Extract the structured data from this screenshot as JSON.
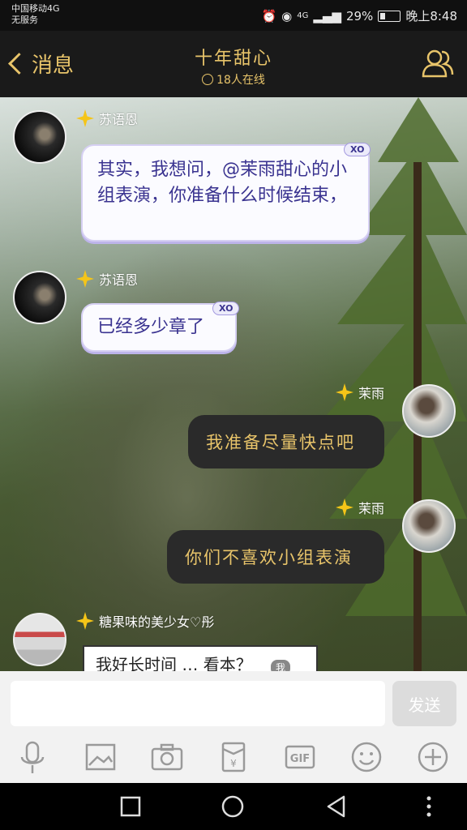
{
  "status_bar": {
    "carrier_line1": "中国移动4G",
    "carrier_line2": "无服务",
    "network": "4G",
    "battery": "29%",
    "time": "晚上8:48"
  },
  "header": {
    "back_label": "消息",
    "title": "十年甜心",
    "online": "18人在线"
  },
  "messages": [
    {
      "sender": "苏语恩",
      "text": "其实，我想问，@茉雨甜心的小组表演，你准备什么时候结束，",
      "badge": "XO"
    },
    {
      "sender": "苏语恩",
      "text": "已经多少章了",
      "badge": "XO"
    },
    {
      "sender": "茉雨",
      "text": "我准备尽量快点吧"
    },
    {
      "sender": "茉雨",
      "text": "你们不喜欢小组表演"
    },
    {
      "sender": "糖果味的美少女♡彤",
      "text": "我好长时间 … 看本？",
      "tag": "我"
    }
  ],
  "input": {
    "placeholder": "",
    "send_label": "发送"
  },
  "toolbar": {
    "gif_label": "GIF",
    "money_label": "¥"
  },
  "colors": {
    "accent": "#e8c46a",
    "bubble_text": "#3a3390",
    "header_bg": "#1a1a1a"
  }
}
